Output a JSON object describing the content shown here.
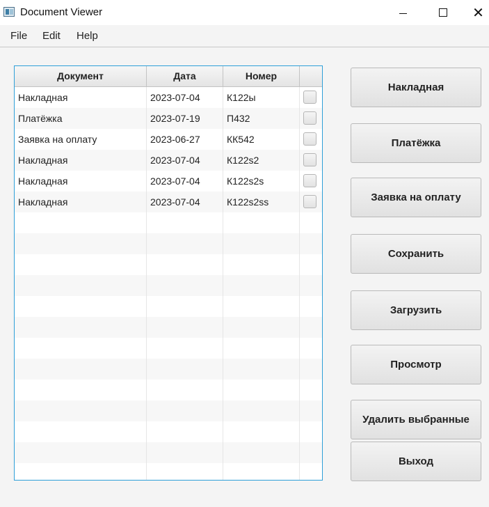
{
  "window": {
    "title": "Document Viewer",
    "icons": {
      "app": "app-icon",
      "minimize": "minimize-icon",
      "maximize": "maximize-icon",
      "close": "close-icon"
    }
  },
  "menu": [
    "File",
    "Edit",
    "Help"
  ],
  "table": {
    "columns": [
      "Документ",
      "Дата",
      "Номер",
      ""
    ],
    "rows": [
      {
        "doc": "Накладная",
        "date": "2023-07-04",
        "num": "К122ы",
        "checked": false
      },
      {
        "doc": "Платёжка",
        "date": "2023-07-19",
        "num": "П432",
        "checked": false
      },
      {
        "doc": "Заявка на оплату",
        "date": "2023-06-27",
        "num": "КК542",
        "checked": false
      },
      {
        "doc": "Накладная",
        "date": "2023-07-04",
        "num": "К122s2",
        "checked": false
      },
      {
        "doc": "Накладная",
        "date": "2023-07-04",
        "num": "К122s2s",
        "checked": false
      },
      {
        "doc": "Накладная",
        "date": "2023-07-04",
        "num": "К122s2ss",
        "checked": false
      }
    ]
  },
  "buttons": {
    "invoice": "Накладная",
    "payment": "Платёжка",
    "request": "Заявка на оплату",
    "save": "Сохранить",
    "load": "Загрузить",
    "view": "Просмотр",
    "delete": "Удалить выбранные",
    "exit": "Выход"
  },
  "colors": {
    "table_border": "#2d9fd8",
    "background": "#f4f4f4"
  }
}
